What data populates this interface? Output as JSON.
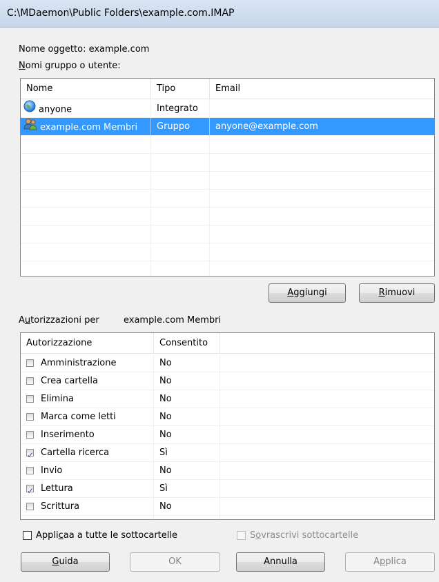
{
  "window": {
    "title": "C:\\MDaemon\\Public Folders\\example.com.IMAP"
  },
  "object": {
    "label": "Nome oggetto: example.com"
  },
  "groups": {
    "label": "Nomi gruppo o utente:",
    "columns": [
      "Nome",
      "Tipo",
      "Email"
    ],
    "rows": [
      {
        "name": "anyone",
        "type": "Integrato",
        "email": "",
        "icon": "globe-icon",
        "selected": false
      },
      {
        "name": "example.com Membri",
        "type": "Gruppo",
        "email": "anyone@example.com",
        "icon": "group-icon",
        "selected": true
      }
    ],
    "add_label": "Aggiungi",
    "remove_label": "Rimuovi"
  },
  "permissions": {
    "label_prefix": "Autorizzazioni per",
    "target": "example.com Membri",
    "columns": [
      "Autorizzazione",
      "Consentito"
    ],
    "rows": [
      {
        "name": "Amministrazione",
        "allowed": "No",
        "checked": false
      },
      {
        "name": "Crea cartella",
        "allowed": "No",
        "checked": false
      },
      {
        "name": "Elimina",
        "allowed": "No",
        "checked": false
      },
      {
        "name": "Marca come letti",
        "allowed": "No",
        "checked": false
      },
      {
        "name": "Inserimento",
        "allowed": "No",
        "checked": false
      },
      {
        "name": "Cartella ricerca",
        "allowed": "Sì",
        "checked": true
      },
      {
        "name": "Invio",
        "allowed": "No",
        "checked": false
      },
      {
        "name": "Lettura",
        "allowed": "Sì",
        "checked": true
      },
      {
        "name": "Scrittura",
        "allowed": "No",
        "checked": false
      }
    ]
  },
  "options": {
    "apply_all": "Applica a tutte le sottocartelle",
    "overwrite": "Sovrascrivi sottocartelle"
  },
  "buttons": {
    "help": "Guida",
    "ok": "OK",
    "cancel": "Annulla",
    "apply": "Applica"
  },
  "colors": {
    "selection": "#3399ff",
    "titlebar": "#c6d6ea",
    "checkmark": "#2b4fa0"
  }
}
